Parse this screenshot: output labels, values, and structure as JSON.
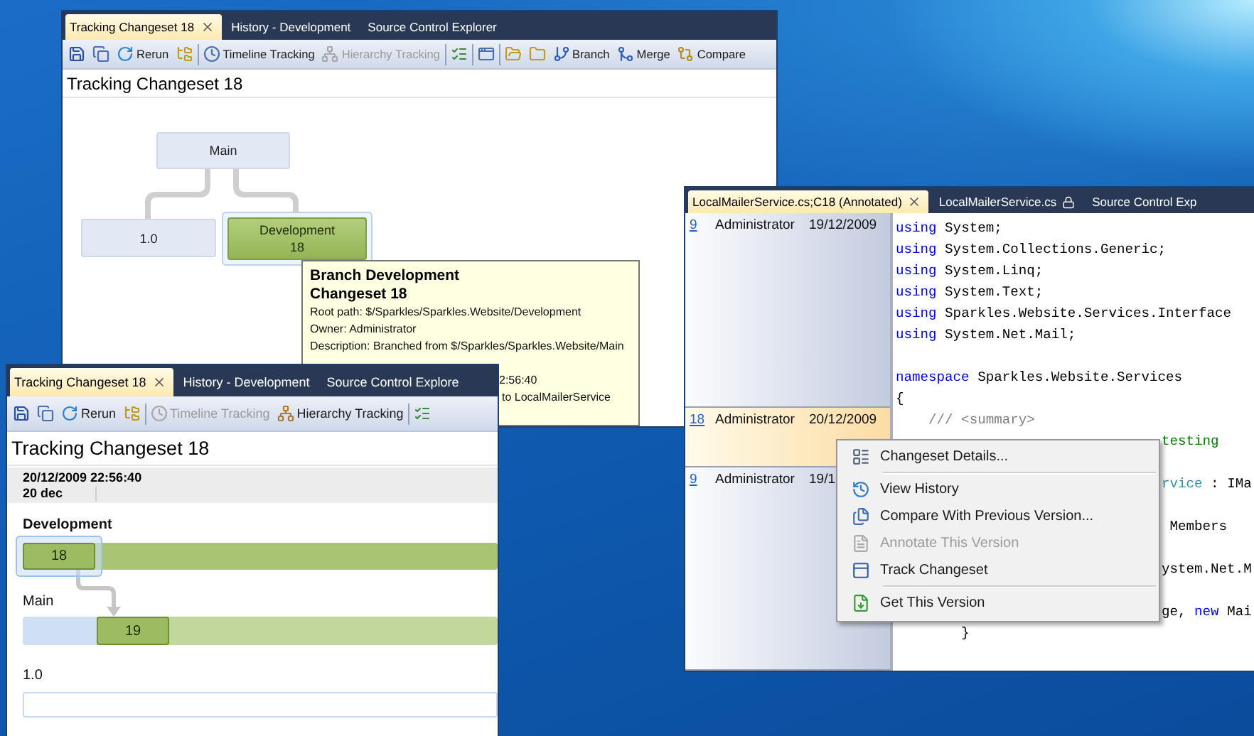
{
  "hierarchy_window": {
    "tabs": [
      {
        "label": "Tracking Changeset 18",
        "selected": true
      },
      {
        "label": "History - Development",
        "selected": false
      },
      {
        "label": "Source Control Explorer",
        "selected": false
      }
    ],
    "toolbar": [
      {
        "kind": "button",
        "disabled": false
      },
      {
        "kind": "button",
        "disabled": false
      },
      {
        "kind": "button",
        "label": "Rerun",
        "disabled": false
      },
      {
        "kind": "button",
        "disabled": false
      },
      {
        "kind": "separator"
      },
      {
        "kind": "button",
        "label": "Timeline Tracking",
        "disabled": false
      },
      {
        "kind": "button",
        "label": "Hierarchy Tracking",
        "disabled": true
      },
      {
        "kind": "separator"
      },
      {
        "kind": "button",
        "disabled": false
      },
      {
        "kind": "separator"
      },
      {
        "kind": "button",
        "disabled": false
      },
      {
        "kind": "separator"
      },
      {
        "kind": "button",
        "disabled": false
      },
      {
        "kind": "button",
        "disabled": false
      },
      {
        "kind": "button",
        "label": "Branch",
        "disabled": false
      },
      {
        "kind": "button",
        "label": "Merge",
        "disabled": false
      },
      {
        "kind": "button",
        "label": "Compare",
        "disabled": false
      }
    ],
    "heading": "Tracking Changeset 18",
    "nodes": [
      {
        "label": "Main",
        "selected": false
      },
      {
        "label": "1.0",
        "selected": false
      },
      {
        "label": "Development",
        "changeset": "18",
        "selected": true
      }
    ]
  },
  "tooltip": {
    "title": "Branch Development",
    "subtitle": "Changeset 18",
    "lines": [
      "Root path: $/Sparkles/Sparkles.Website/Development",
      "Owner: Administrator",
      "Description: Branched from $/Sparkles/Sparkles.Website/Main"
    ],
    "tail_lines": [
      "2:56:40",
      "to LocalMailerService"
    ]
  },
  "timeline_window": {
    "tabs": [
      {
        "label": "Tracking Changeset 18",
        "selected": true
      },
      {
        "label": "History - Development",
        "selected": false
      },
      {
        "label": "Source Control Explore",
        "selected": false
      }
    ],
    "toolbar": [
      {
        "kind": "button",
        "disabled": false
      },
      {
        "kind": "button",
        "disabled": false
      },
      {
        "kind": "button",
        "label": "Rerun",
        "disabled": false
      },
      {
        "kind": "button",
        "disabled": false
      },
      {
        "kind": "separator"
      },
      {
        "kind": "button",
        "label": "Timeline Tracking",
        "disabled": true
      },
      {
        "kind": "button",
        "label": "Hierarchy Tracking",
        "disabled": false
      },
      {
        "kind": "separator"
      },
      {
        "kind": "button",
        "disabled": false
      }
    ],
    "heading": "Tracking Changeset 18",
    "timestamp": "20/12/2009 22:56:40",
    "day": "20 dec",
    "branches": [
      {
        "name": "Development",
        "kind": "active",
        "changesets": [
          {
            "label": "18",
            "selected": true
          }
        ]
      },
      {
        "name": "Main",
        "kind": "merged",
        "changesets": [
          {
            "label": "19",
            "selected": false
          }
        ]
      },
      {
        "name": "1.0",
        "kind": "empty"
      }
    ]
  },
  "annotate_window": {
    "tabs": [
      {
        "label": "LocalMailerService.cs;C18 (Annotated)",
        "selected": true,
        "locked": false
      },
      {
        "label": "LocalMailerService.cs",
        "selected": false,
        "locked": true
      },
      {
        "label": "Source Control Exp",
        "selected": false,
        "locked": false
      }
    ],
    "annotations": [
      {
        "changeset": "9",
        "author": "Administrator",
        "date": "19/12/2009",
        "selected": false
      },
      {
        "changeset": "18",
        "author": "Administrator",
        "date": "20/12/2009",
        "selected": true
      },
      {
        "changeset": "9",
        "author": "Administrator",
        "date": "19/1",
        "selected": false
      }
    ],
    "code": [
      {
        "kind": "code",
        "segments": [
          {
            "kind": "keyword",
            "text": "using"
          },
          {
            "kind": "plain",
            "text": " System;"
          }
        ]
      },
      {
        "kind": "code",
        "segments": [
          {
            "kind": "keyword",
            "text": "using"
          },
          {
            "kind": "plain",
            "text": " System.Collections.Generic;"
          }
        ]
      },
      {
        "kind": "code",
        "segments": [
          {
            "kind": "keyword",
            "text": "using"
          },
          {
            "kind": "plain",
            "text": " System.Linq;"
          }
        ]
      },
      {
        "kind": "code",
        "segments": [
          {
            "kind": "keyword",
            "text": "using"
          },
          {
            "kind": "plain",
            "text": " System.Text;"
          }
        ]
      },
      {
        "kind": "code",
        "segments": [
          {
            "kind": "keyword",
            "text": "using"
          },
          {
            "kind": "plain",
            "text": " Sparkles.Website.Services.Interface"
          }
        ]
      },
      {
        "kind": "code",
        "segments": [
          {
            "kind": "keyword",
            "text": "using"
          },
          {
            "kind": "plain",
            "text": " System.Net.Mail;"
          }
        ]
      },
      {
        "kind": "blank"
      },
      {
        "kind": "code",
        "segments": [
          {
            "kind": "keyword",
            "text": "namespace"
          },
          {
            "kind": "plain",
            "text": " Sparkles.Website.Services"
          }
        ]
      },
      {
        "kind": "code",
        "segments": [
          {
            "kind": "plain",
            "text": "{"
          }
        ]
      },
      {
        "kind": "code",
        "segments": [
          {
            "kind": "doc",
            "text": "    /// <summary>"
          }
        ]
      },
      {
        "kind": "tail",
        "segments": [
          {
            "kind": "comment",
            "text": "testing"
          }
        ]
      },
      {
        "kind": "blank"
      },
      {
        "kind": "tail",
        "segments": [
          {
            "kind": "type",
            "text": "rvice"
          },
          {
            "kind": "plain",
            "text": " : IMa"
          }
        ]
      },
      {
        "kind": "blank"
      },
      {
        "kind": "tail",
        "segments": [
          {
            "kind": "plain",
            "text": " Members"
          }
        ]
      },
      {
        "kind": "blank"
      },
      {
        "kind": "tail",
        "segments": [
          {
            "kind": "plain",
            "text": "ystem.Net.M"
          }
        ]
      },
      {
        "kind": "blank"
      },
      {
        "kind": "tail",
        "segments": [
          {
            "kind": "plain",
            "text": "ge, "
          },
          {
            "kind": "keyword",
            "text": "new"
          },
          {
            "kind": "plain",
            "text": " Mai"
          }
        ]
      },
      {
        "kind": "code",
        "segments": [
          {
            "kind": "plain",
            "text": "        }"
          }
        ]
      }
    ]
  },
  "context_menu": {
    "items": [
      {
        "kind": "item",
        "label": "Changeset Details...",
        "disabled": false
      },
      {
        "kind": "separator"
      },
      {
        "kind": "item",
        "label": "View History",
        "disabled": false
      },
      {
        "kind": "item",
        "label": "Compare With Previous Version...",
        "disabled": false
      },
      {
        "kind": "item",
        "label": "Annotate This Version",
        "disabled": true
      },
      {
        "kind": "item",
        "label": "Track Changeset",
        "disabled": false
      },
      {
        "kind": "separator"
      },
      {
        "kind": "item",
        "label": "Get This Version",
        "disabled": false
      }
    ]
  }
}
